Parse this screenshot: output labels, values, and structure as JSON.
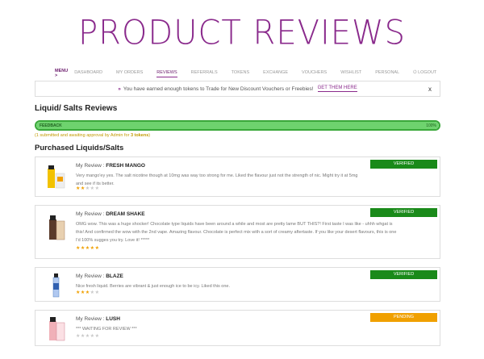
{
  "hero_title": "PRODUCT REVIEWS",
  "nav": {
    "menu_label": "MENU >",
    "items": [
      "DASHBOARD",
      "MY ORDERS",
      "REVIEWS",
      "REFERRALS",
      "TOKENS",
      "EXCHANGE",
      "VOUCHERS",
      "WISHLIST",
      "PERSONAL",
      "LOGOUT"
    ],
    "active": "REVIEWS"
  },
  "banner": {
    "arrows": "»",
    "message": "You have earned enough tokens to Trade for New Discount Vouchers or Freebies!",
    "cta": "GET THEM HERE",
    "close": "x"
  },
  "section_title": "Liquid/ Salts Reviews",
  "progress": {
    "label": "FEEDBACK",
    "percent_text": "100%",
    "value": 1.0
  },
  "note": {
    "text": "(1 submitted and awaiting approval by Admin for ",
    "tokens": "3 tokens",
    "end": ")"
  },
  "purchased_title": "Purchased Liquids/Salts",
  "reviews": [
    {
      "prefix": "My Review :",
      "product": "FRESH MANGO",
      "text": "Very mango'ey yes. The salt nicotine though at 10mg was way too strong for me. Liked the flavour just not the strength of nic. Might try it at 5mg and see if its better.",
      "rating": 2,
      "status": "VERIFIED",
      "status_color": "#1a8a1a"
    },
    {
      "prefix": "My Review :",
      "product": "DREAM SHAKE",
      "text": "OMG wow. This was a huge shocker! Chocolate type liquids have been around a while and most are pretty lame BUT THIS?! First taste I was like - uhhh whgat is this! And confirmed the wow with the 2nd vape. Amazing flavour. Chocolate is perfect mix with a sort of creamy aftertaste. If you like your desert flavours, this is one I'd 100% sugges you try. Love it! *****",
      "rating": 5,
      "status": "VERIFIED",
      "status_color": "#1a8a1a"
    },
    {
      "prefix": "My Review :",
      "product": "BLAZE",
      "text": "Nice fresh liquid. Berries are vibrant & just enough ice to be icy. Liked this one.",
      "rating": 3,
      "status": "VERIFIED",
      "status_color": "#1a8a1a"
    },
    {
      "prefix": "My Review :",
      "product": "LUSH",
      "text": "*** WAITING FOR REVIEW ***",
      "rating": 0,
      "status": "PENDING",
      "status_color": "#f0a000"
    }
  ],
  "icons": {
    "logout": "power-icon",
    "close": "close-icon",
    "star": "star-icon"
  },
  "colors": {
    "brand": "#8a2a8c",
    "verified": "#1a8a1a",
    "pending": "#f0a000",
    "progress": "#6ed36e",
    "star": "#f0a000"
  }
}
